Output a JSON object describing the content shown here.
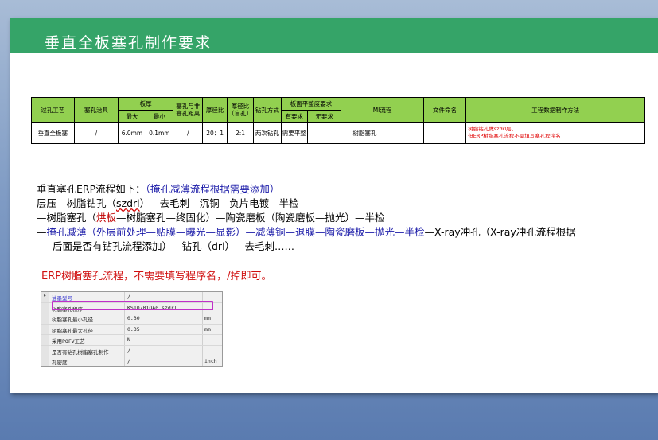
{
  "title": "垂直全板塞孔制作要求",
  "table": {
    "headers": {
      "via_process": "过孔工艺",
      "plug_tool": "塞孔治具",
      "board_thickness": "板厚",
      "max": "最大",
      "min": "最小",
      "plug_nonplug_distance": "塞孔与非塞孔距离",
      "thickness_ratio": "厚径比",
      "thickness_ratio_blind": "厚径比（盲孔）",
      "drill_method": "钻孔方式",
      "flatness": "板面平整度要求",
      "required": "有要求",
      "not_required": "无要求",
      "mi_flow": "MI流程",
      "file_naming": "文件命名",
      "eng_method": "工程数据制作方法"
    },
    "row": {
      "via_process": "垂直全板塞",
      "plug_tool": "/",
      "max": "6.0mm",
      "min": "0.1mm",
      "distance": "/",
      "ratio": "20：1",
      "ratio_blind": "2:1",
      "drill": "两次钻孔",
      "required": "需要平整",
      "not_required": "",
      "mi_flow": "树脂塞孔",
      "mi_flow_extra": "",
      "file_naming": "",
      "method_line1": "树脂钻孔做szdrl层，",
      "method_line2": "但ERP树脂塞孔流程不需填写塞孔程序名"
    }
  },
  "body": {
    "line1_a": "垂直塞孔ERP流程如下：",
    "line1_b": "（掩孔减薄流程根据需要添加）",
    "line2_a": "层压—树脂钻孔（",
    "line2_b": "szdrl",
    "line2_c": "）—去毛刺—沉铜—负片电镀—半检",
    "line3_a": "—树脂塞孔（",
    "line3_b": "烘板",
    "line3_c": "—树脂塞孔—终固化）—陶瓷磨板（陶瓷磨板—抛光）—半检",
    "line4_a": "—",
    "line4_b": "掩孔减薄（外层前处理—贴膜—曝光—显影）—减薄铜—退膜—陶瓷磨板—抛光—半检",
    "line4_c": "—X-ray冲孔（X-ray冲孔流程根据",
    "line5": "后面是否有钻孔流程添加）—钻孔（drl）—去毛刺……"
  },
  "note": "ERP树脂塞孔流程，不需要填写程序名，/掉即可。",
  "erp_panel": {
    "rows": [
      {
        "key": "油墨型号",
        "value": "/",
        "unit": ""
      },
      {
        "key": "树脂塞孔程序",
        "value": "KS10701QA0.szdrl",
        "unit": ""
      },
      {
        "key": "树脂塞孔最小孔径",
        "value": "0.30",
        "unit": "mm"
      },
      {
        "key": "树脂塞孔最大孔径",
        "value": "0.35",
        "unit": "mm"
      },
      {
        "key": "采用POFV工艺",
        "value": "N",
        "unit": ""
      },
      {
        "key": "是否有钻孔树脂塞孔制作",
        "value": "/",
        "unit": ""
      },
      {
        "key": "孔密度",
        "value": "/",
        "unit": "inch"
      }
    ]
  },
  "colors": {
    "title_bar": "#35a468",
    "header_fill": "#92d050",
    "red_text": "#d01010",
    "blue_text": "#1a1aa8",
    "highlight": "#c030c8"
  }
}
